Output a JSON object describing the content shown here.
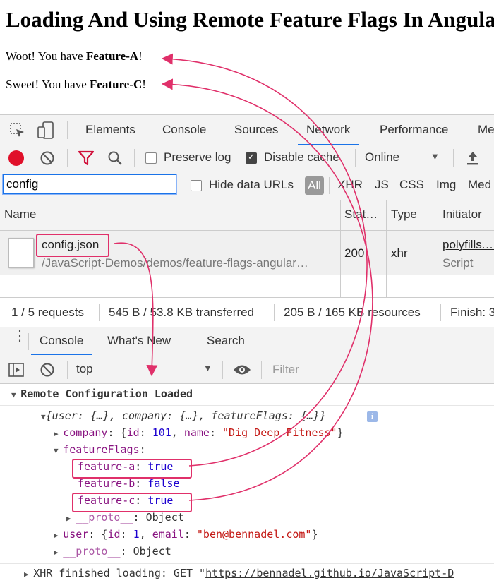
{
  "page": {
    "title": "Loading And Using Remote Feature Flags In Angular",
    "messages": [
      {
        "prefix": "Woot! You have ",
        "flag": "Feature-A",
        "suffix": "!"
      },
      {
        "prefix": "Sweet! You have ",
        "flag": "Feature-C",
        "suffix": "!"
      }
    ]
  },
  "devtools": {
    "tabs": [
      "Elements",
      "Console",
      "Sources",
      "Network",
      "Performance",
      "Me"
    ],
    "active_tab": "Network",
    "network_toolbar": {
      "preserve_log": "Preserve log",
      "preserve_log_checked": false,
      "disable_cache": "Disable cache",
      "disable_cache_checked": true,
      "throttle": "Online"
    },
    "filter": {
      "value": "config",
      "hide_data_urls": "Hide data URLs",
      "types": [
        "All",
        "XHR",
        "JS",
        "CSS",
        "Img",
        "Med"
      ],
      "selected_type": "All"
    },
    "columns": [
      "Name",
      "Stat…",
      "Type",
      "Initiator"
    ],
    "rows": [
      {
        "name": "config.json",
        "path": "/JavaScript-Demos/demos/feature-flags-angular…",
        "status": "200",
        "type": "xhr",
        "initiator": "polyfills.…",
        "initiator_sub": "Script"
      }
    ],
    "summary": {
      "requests": "1 / 5 requests",
      "transferred": "545 B / 53.8 KB transferred",
      "resources": "205 B / 165 KB resources",
      "finish": "Finish: 3"
    },
    "console_tabs": [
      "Console",
      "What's New",
      "Search"
    ],
    "active_console_tab": "Console",
    "console_toolbar": {
      "context": "top",
      "filter_placeholder": "Filter"
    },
    "console": {
      "group_label": "Remote Configuration Loaded",
      "object_preview": "{user: {…}, company: {…}, featureFlags: {…}}",
      "company_key": "company",
      "company_id_key": "id",
      "company_id": "101",
      "company_name_key": "name",
      "company_name": "\"Dig Deep Fitness\"",
      "feature_flags_key": "featureFlags",
      "flags": [
        {
          "key": "feature-a",
          "value": "true"
        },
        {
          "key": "feature-b",
          "value": "false"
        },
        {
          "key": "feature-c",
          "value": "true"
        }
      ],
      "proto_key": "__proto__",
      "proto_value": "Object",
      "user_key": "user",
      "user_id_key": "id",
      "user_id": "1",
      "user_email_key": "email",
      "user_email": "\"ben@bennadel.com\"",
      "xhr_prefix": "XHR finished loading: GET \"",
      "xhr_url": "https://bennadel.github.io/JavaScript-D"
    }
  },
  "colors": {
    "annotation": "#e0306a",
    "accent": "#1a73e8",
    "record": "#e0102a"
  }
}
